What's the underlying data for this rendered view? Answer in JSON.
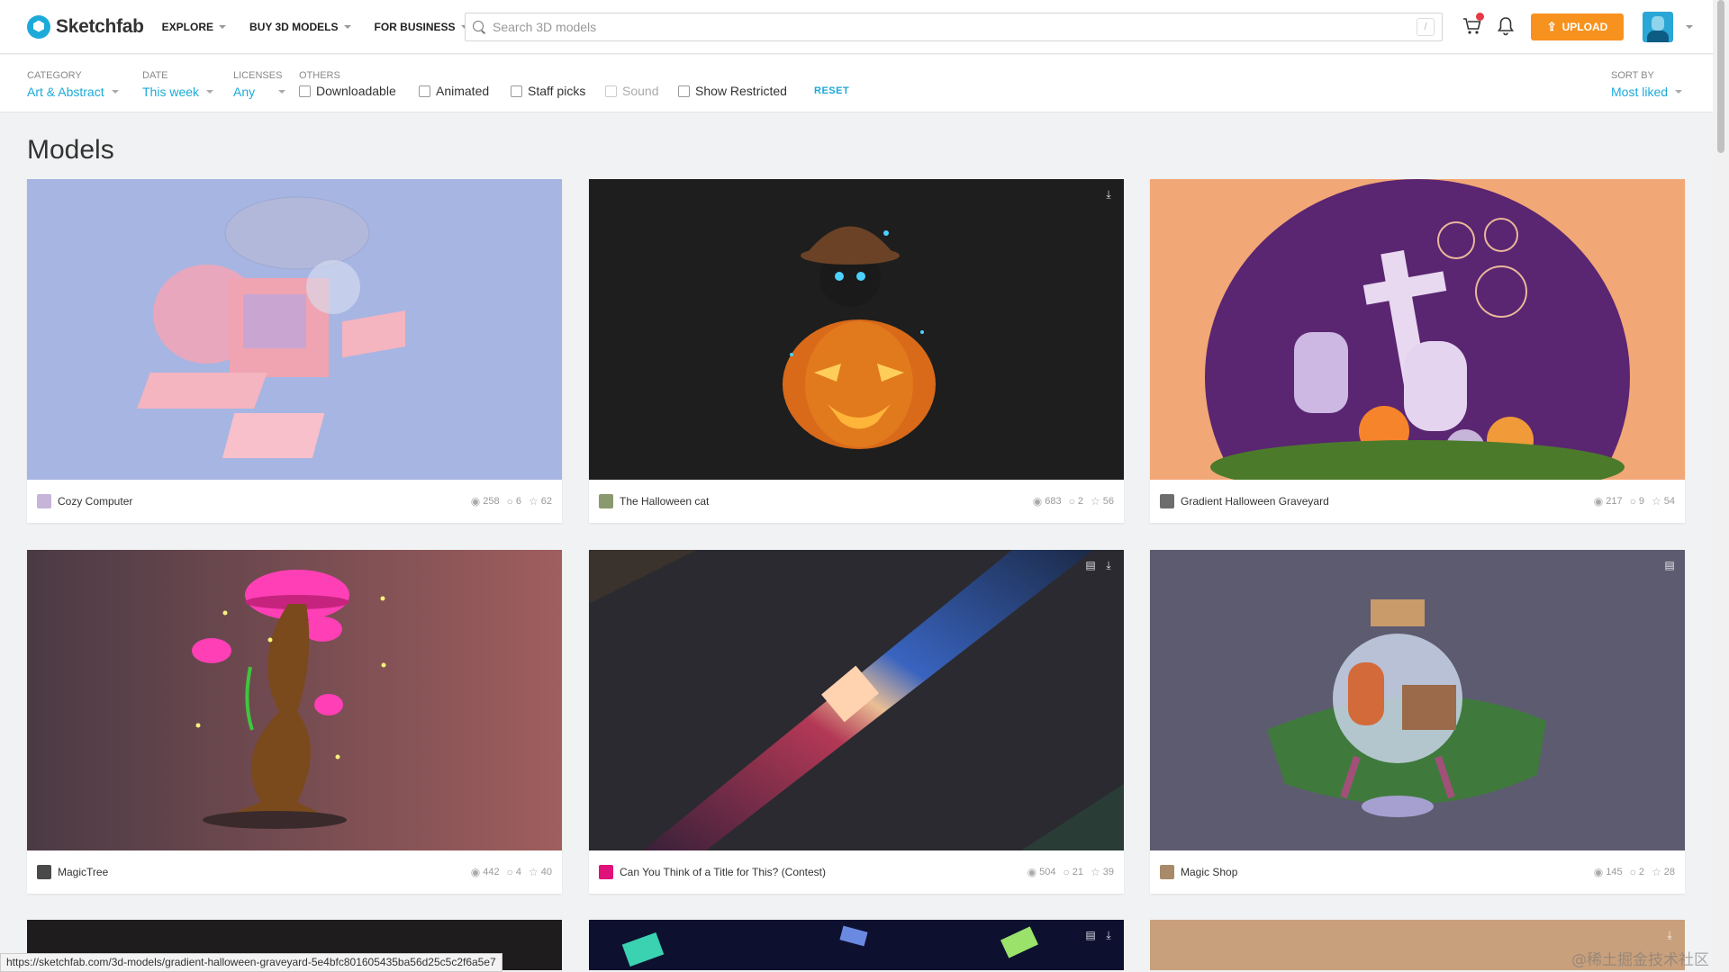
{
  "header": {
    "logo_text": "Sketchfab",
    "nav": [
      "EXPLORE",
      "BUY 3D MODELS",
      "FOR BUSINESS"
    ],
    "search_placeholder": "Search 3D models",
    "search_shortcut": "/",
    "upload_label": "UPLOAD"
  },
  "filters": {
    "category": {
      "label": "CATEGORY",
      "value": "Art & Abstract"
    },
    "date": {
      "label": "DATE",
      "value": "This week"
    },
    "licenses": {
      "label": "LICENSES",
      "value": "Any"
    },
    "others_label": "OTHERS",
    "checks": [
      "Downloadable",
      "Animated",
      "Staff picks",
      "Sound",
      "Show Restricted"
    ],
    "reset": "RESET",
    "sort": {
      "label": "SORT BY",
      "value": "Most liked"
    }
  },
  "main": {
    "title": "Models",
    "cards": [
      {
        "title": "Cozy Computer",
        "views": "258",
        "comments": "6",
        "likes": "62"
      },
      {
        "title": "The Halloween cat",
        "views": "683",
        "comments": "2",
        "likes": "56"
      },
      {
        "title": "Gradient Halloween Graveyard",
        "views": "217",
        "comments": "9",
        "likes": "54"
      },
      {
        "title": "MagicTree",
        "views": "442",
        "comments": "4",
        "likes": "40"
      },
      {
        "title": "Can You Think of a Title for This? (Contest)",
        "views": "504",
        "comments": "21",
        "likes": "39"
      },
      {
        "title": "Magic Shop",
        "views": "145",
        "comments": "2",
        "likes": "28"
      }
    ]
  },
  "status_url": "https://sketchfab.com/3d-models/gradient-halloween-graveyard-5e4bfc801605435ba56d25c5c2f6a5e7",
  "watermark": "@稀土掘金技术社区",
  "colors": {
    "accent": "#1caad9",
    "upload": "#f7921e"
  }
}
